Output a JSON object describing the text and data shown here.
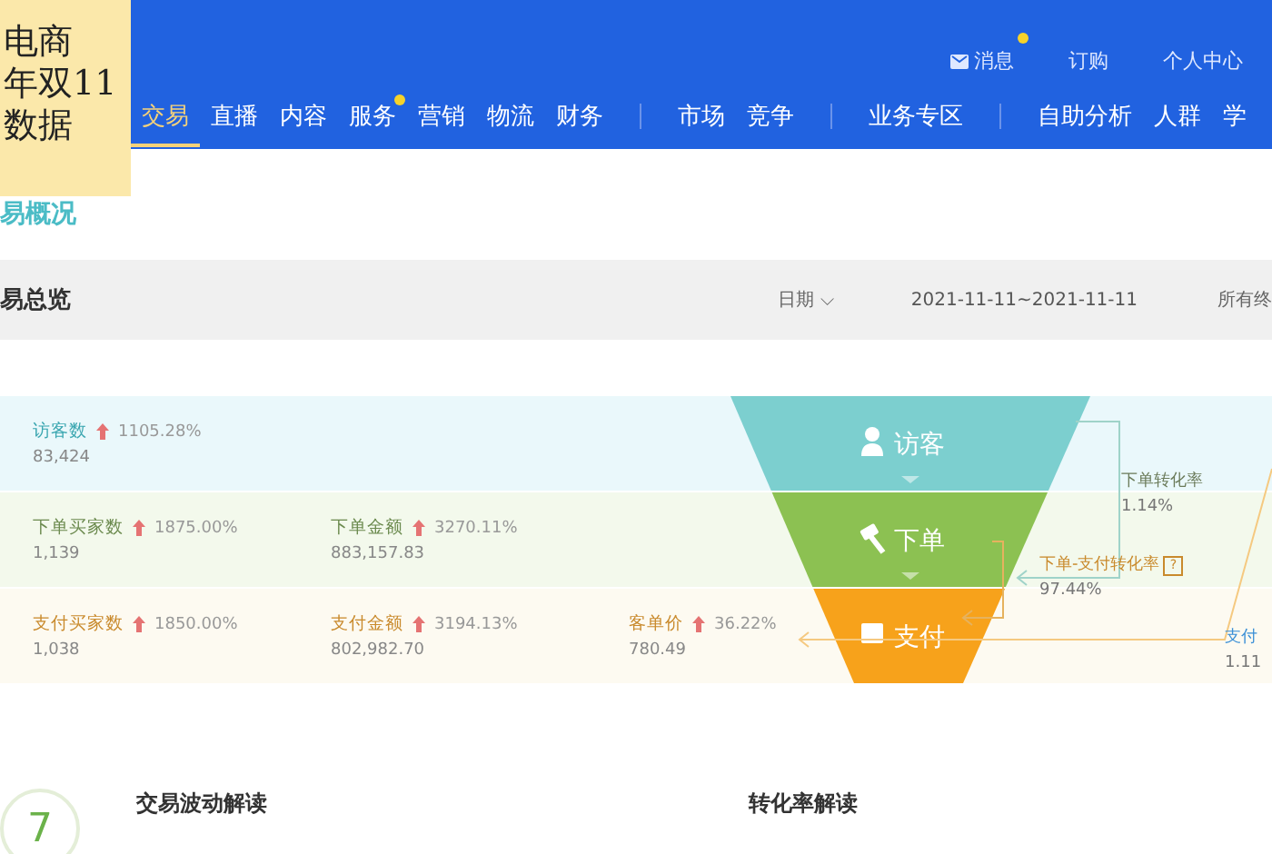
{
  "caption": {
    "lines": [
      "电商",
      "年双11",
      "数据"
    ]
  },
  "top_links": [
    {
      "kind": "message",
      "label": "消息",
      "dot": true
    },
    {
      "kind": "plain",
      "label": "订购",
      "dot": false
    },
    {
      "kind": "plain",
      "label": "个人中心",
      "dot": false
    }
  ],
  "nav": [
    {
      "kind": "item",
      "label": "交易",
      "selected": true,
      "dot": false
    },
    {
      "kind": "item",
      "label": "直播",
      "selected": false,
      "dot": false
    },
    {
      "kind": "item",
      "label": "内容",
      "selected": false,
      "dot": false
    },
    {
      "kind": "item",
      "label": "服务",
      "selected": false,
      "dot": true
    },
    {
      "kind": "item",
      "label": "营销",
      "selected": false,
      "dot": false
    },
    {
      "kind": "item",
      "label": "物流",
      "selected": false,
      "dot": false
    },
    {
      "kind": "item",
      "label": "财务",
      "selected": false,
      "dot": false
    },
    {
      "kind": "divider"
    },
    {
      "kind": "item",
      "label": "市场",
      "selected": false,
      "dot": false
    },
    {
      "kind": "item",
      "label": "竞争",
      "selected": false,
      "dot": false
    },
    {
      "kind": "divider"
    },
    {
      "kind": "item",
      "label": "业务专区",
      "selected": false,
      "dot": false
    },
    {
      "kind": "divider"
    },
    {
      "kind": "item",
      "label": "自助分析",
      "selected": false,
      "dot": false
    },
    {
      "kind": "item",
      "label": "人群",
      "selected": false,
      "dot": false
    },
    {
      "kind": "item",
      "label": "学",
      "selected": false,
      "dot": false
    }
  ],
  "page_title": "易概况",
  "overview": {
    "title": "易总览",
    "date_label": "日期",
    "date_caret": "⌵",
    "date_range": "2021-11-11~2021-11-11",
    "terminal": "所有终"
  },
  "rows": [
    {
      "kind": "visitor",
      "metrics": [
        {
          "label": "访客数",
          "change": "1105.28%",
          "value": "83,424"
        }
      ]
    },
    {
      "kind": "order",
      "metrics": [
        {
          "label": "下单买家数",
          "change": "1875.00%",
          "value": "1,139"
        },
        {
          "label": "下单金额",
          "change": "3270.11%",
          "value": "883,157.83"
        }
      ]
    },
    {
      "kind": "pay",
      "metrics": [
        {
          "label": "支付买家数",
          "change": "1850.00%",
          "value": "1,038"
        },
        {
          "label": "支付金额",
          "change": "3194.13%",
          "value": "802,982.70"
        },
        {
          "label": "客单价",
          "change": "36.22%",
          "value": "780.49"
        }
      ]
    }
  ],
  "funnel": {
    "stages": [
      {
        "kind": "visitor",
        "label": "访客",
        "color": "#7ccfcf"
      },
      {
        "kind": "order",
        "label": "下单",
        "color": "#8cc152"
      },
      {
        "kind": "pay",
        "label": "支付",
        "color": "#f7a21b"
      }
    ],
    "rates": [
      {
        "label": "下单转化率",
        "value": "1.14%"
      },
      {
        "label": "下单-支付转化率",
        "help": "?",
        "value": "97.44%"
      },
      {
        "label": "支付",
        "value": "1.11"
      }
    ]
  },
  "insights": {
    "badge": "7",
    "titles": [
      "交易波动解读",
      "转化率解读"
    ]
  }
}
